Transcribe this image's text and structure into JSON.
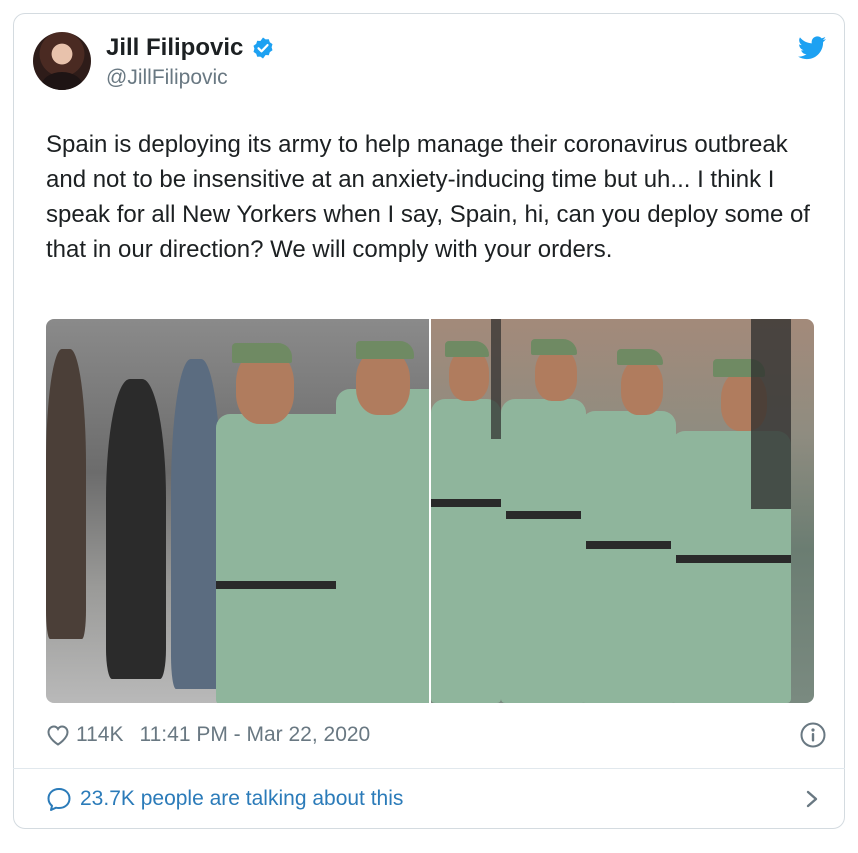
{
  "author": {
    "name": "Jill Filipovic",
    "handle": "@JillFilipovic",
    "avatar_icon": "avatar-photo",
    "verified_icon": "verified-badge-icon"
  },
  "brand": {
    "icon": "twitter-bird-icon",
    "color": "#1da1f2"
  },
  "tweet": {
    "text": "Spain is deploying its army to help manage their coronavirus outbreak and not to be insensitive at an anxiety-inducing time but uh... I think I speak for all New Yorkers when I say, Spain, hi, can you deploy some of that in our direction? We will comply with your orders."
  },
  "media": {
    "photos": [
      {
        "name": "photo-soldiers-crowd"
      },
      {
        "name": "photo-soldiers-parade"
      }
    ]
  },
  "footer": {
    "likes": "114K",
    "timestamp": "11:41 PM - Mar 22, 2020",
    "like_icon": "heart-icon",
    "info_icon": "info-icon"
  },
  "conversation": {
    "label": "23.7K people are talking about this",
    "icon": "speech-bubble-icon",
    "chevron_icon": "chevron-right-icon",
    "link_color": "#2b7bb9"
  }
}
